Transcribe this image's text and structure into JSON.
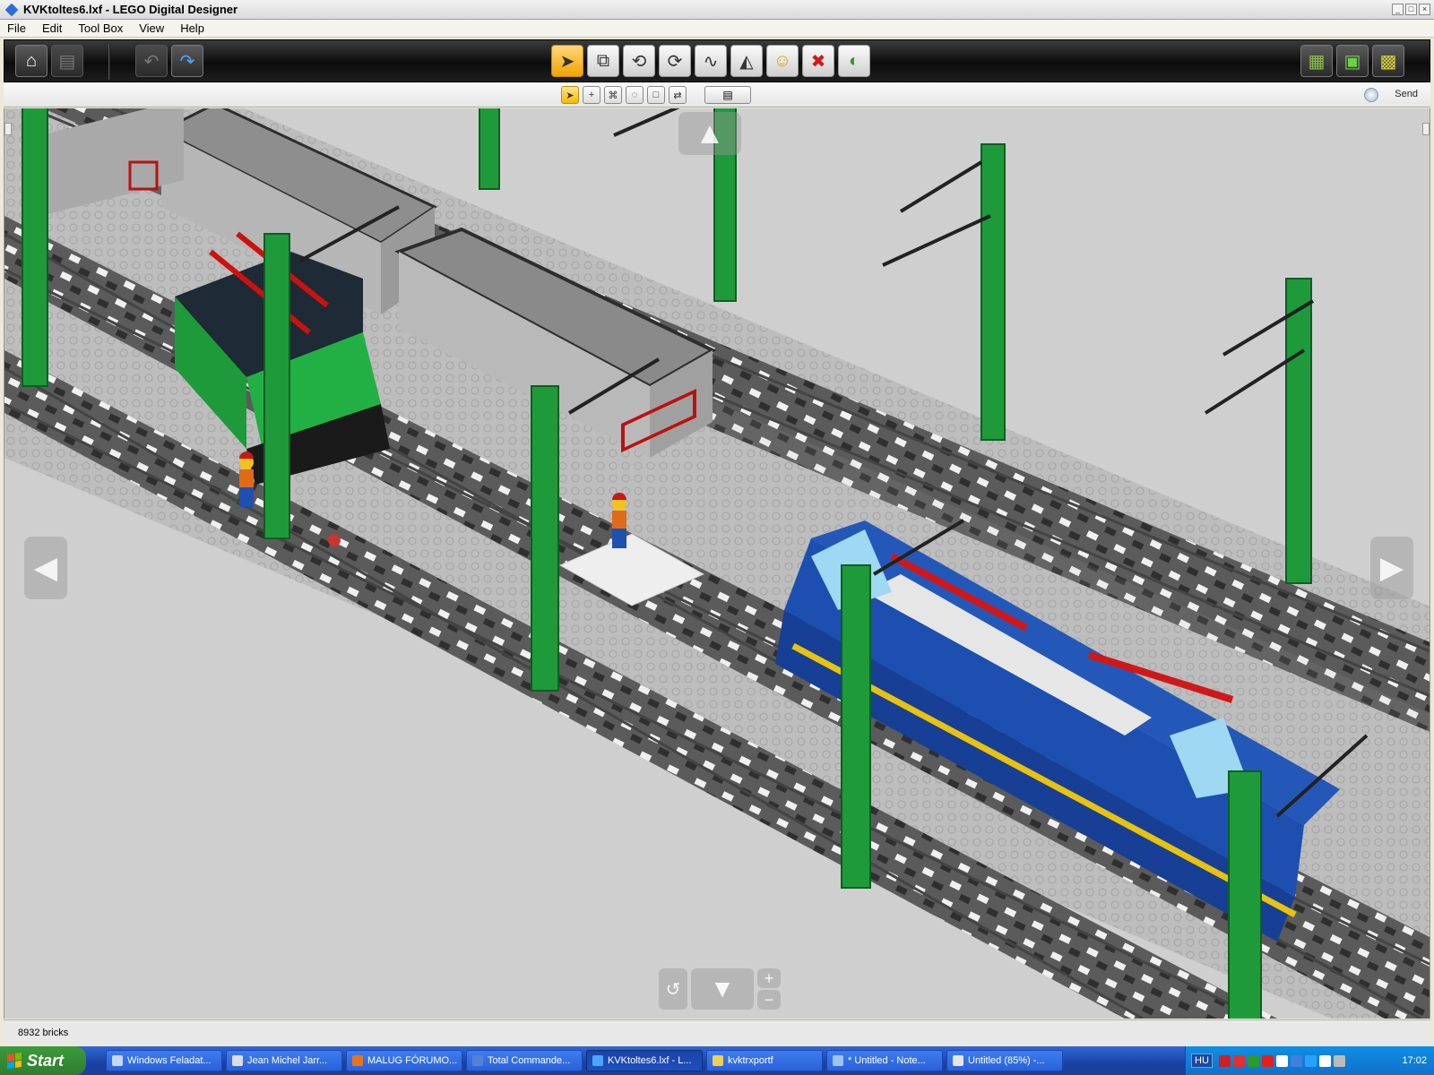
{
  "window": {
    "title": "KVKtoltes6.lxf - LEGO Digital Designer",
    "controls": [
      "_",
      "□",
      "×"
    ]
  },
  "menu": [
    "File",
    "Edit",
    "Tool Box",
    "View",
    "Help"
  ],
  "toolbar": {
    "left": [
      {
        "name": "home-button",
        "icon": "house-icon",
        "glyph": "⌂",
        "state": "enabled"
      },
      {
        "name": "save-button",
        "icon": "floppy-disk-icon",
        "glyph": "▤",
        "state": "disabled"
      },
      {
        "name": "undo-button",
        "icon": "undo-arrow-icon",
        "glyph": "↶",
        "state": "disabled"
      },
      {
        "name": "redo-button",
        "icon": "redo-arrow-icon",
        "glyph": "↷",
        "state": "enabled"
      }
    ],
    "tools": [
      {
        "name": "select-tool-button",
        "icon": "cursor-arrow-icon",
        "glyph": "➤",
        "active": true
      },
      {
        "name": "clone-tool-button",
        "icon": "clone-brick-icon",
        "glyph": "⧉",
        "active": false
      },
      {
        "name": "hinge-tool-button",
        "icon": "hinge-icon",
        "glyph": "⟲",
        "active": false
      },
      {
        "name": "hinge-align-tool-button",
        "icon": "hinge-align-icon",
        "glyph": "⟳",
        "active": false
      },
      {
        "name": "flex-tool-button",
        "icon": "flex-icon",
        "glyph": "∿",
        "active": false
      },
      {
        "name": "paint-tool-button",
        "icon": "paint-bucket-icon",
        "glyph": "◭",
        "active": false
      },
      {
        "name": "decoration-tool-button",
        "icon": "minifig-head-icon",
        "glyph": "☺",
        "active": false
      },
      {
        "name": "delete-tool-button",
        "icon": "red-x-icon",
        "glyph": "✖",
        "active": false
      },
      {
        "name": "hide-tool-button",
        "icon": "hide-brick-icon",
        "glyph": "◐",
        "active": false
      }
    ],
    "modes": [
      {
        "name": "build-mode-button",
        "icon": "build-mode-icon",
        "glyph": "▦"
      },
      {
        "name": "view-mode-button",
        "icon": "view-mode-icon",
        "glyph": "▣"
      },
      {
        "name": "building-guide-mode-button",
        "icon": "building-guide-icon",
        "glyph": "▩"
      }
    ]
  },
  "subtoolbar": {
    "select_modes": [
      {
        "name": "single-select-button",
        "icon": "cursor-icon",
        "glyph": "➤",
        "active": true
      },
      {
        "name": "select-add-button",
        "icon": "cursor-plus-icon",
        "glyph": "+",
        "active": false
      },
      {
        "name": "select-connected-button",
        "icon": "cursor-connected-icon",
        "glyph": "⌘",
        "active": false
      },
      {
        "name": "select-color-button",
        "icon": "cursor-color-icon",
        "glyph": "◌",
        "active": false
      },
      {
        "name": "select-shape-button",
        "icon": "cursor-shape-icon",
        "glyph": "□",
        "active": false
      },
      {
        "name": "select-invert-button",
        "icon": "cursor-invert-icon",
        "glyph": "⇄",
        "active": false
      }
    ],
    "group_glyph": "▤",
    "send_label": "Send"
  },
  "status": {
    "brick_count": "8932 bricks"
  },
  "viewport_nav": {
    "up": "▲",
    "left": "◀",
    "right": "▶",
    "down": "▼",
    "zoom_in": "+",
    "zoom_out": "−",
    "reset": "↺"
  },
  "taskbar": {
    "start_label": "Start",
    "items": [
      {
        "label": "Windows Feladat...",
        "icon_color": "#c7d7ef",
        "active": false
      },
      {
        "label": "Jean Michel Jarr...",
        "icon_color": "#dddddd",
        "active": false
      },
      {
        "label": "MALUG FÓRUMO...",
        "icon_color": "#e8741a",
        "active": false
      },
      {
        "label": "Total Commande...",
        "icon_color": "#5a7fd8",
        "active": false
      },
      {
        "label": "KVKtoltes6.lxf - L...",
        "icon_color": "#4aa3ff",
        "active": true
      },
      {
        "label": "kvktrxportf",
        "icon_color": "#f2cf53",
        "active": false
      },
      {
        "label": "* Untitled - Note...",
        "icon_color": "#9fc3ef",
        "active": false
      },
      {
        "label": "Untitled (85%) -...",
        "icon_color": "#e6e6e6",
        "active": false
      }
    ],
    "language": "HU",
    "clock": "17:02",
    "tray_colors": [
      "#cc2222",
      "#e03030",
      "#2b9b2b",
      "#e02020",
      "#ffffff",
      "#3f7fe0",
      "#2aa0ff",
      "#ffffff",
      "#bbbbbb"
    ]
  }
}
